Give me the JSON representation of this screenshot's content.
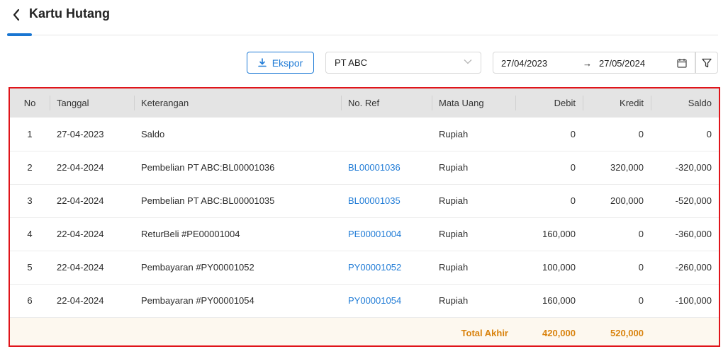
{
  "header": {
    "title": "Kartu Hutang"
  },
  "toolbar": {
    "export_label": "Ekspor",
    "company": "PT ABC",
    "date_start": "27/04/2023",
    "date_end": "27/05/2024",
    "arrow": "→"
  },
  "table": {
    "columns": [
      "No",
      "Tanggal",
      "Keterangan",
      "No. Ref",
      "Mata Uang",
      "Debit",
      "Kredit",
      "Saldo"
    ],
    "rows": [
      {
        "no": "1",
        "tanggal": "27-04-2023",
        "keterangan": "Saldo",
        "ref": "",
        "mata_uang": "Rupiah",
        "debit": "0",
        "kredit": "0",
        "saldo": "0"
      },
      {
        "no": "2",
        "tanggal": "22-04-2024",
        "keterangan": "Pembelian PT ABC:BL00001036",
        "ref": "BL00001036",
        "mata_uang": "Rupiah",
        "debit": "0",
        "kredit": "320,000",
        "saldo": "-320,000"
      },
      {
        "no": "3",
        "tanggal": "22-04-2024",
        "keterangan": "Pembelian PT ABC:BL00001035",
        "ref": "BL00001035",
        "mata_uang": "Rupiah",
        "debit": "0",
        "kredit": "200,000",
        "saldo": "-520,000"
      },
      {
        "no": "4",
        "tanggal": "22-04-2024",
        "keterangan": "ReturBeli #PE00001004",
        "ref": "PE00001004",
        "mata_uang": "Rupiah",
        "debit": "160,000",
        "kredit": "0",
        "saldo": "-360,000"
      },
      {
        "no": "5",
        "tanggal": "22-04-2024",
        "keterangan": "Pembayaran #PY00001052",
        "ref": "PY00001052",
        "mata_uang": "Rupiah",
        "debit": "100,000",
        "kredit": "0",
        "saldo": "-260,000"
      },
      {
        "no": "6",
        "tanggal": "22-04-2024",
        "keterangan": "Pembayaran #PY00001054",
        "ref": "PY00001054",
        "mata_uang": "Rupiah",
        "debit": "160,000",
        "kredit": "0",
        "saldo": "-100,000"
      }
    ],
    "total": {
      "label": "Total Akhir",
      "debit": "420,000",
      "kredit": "520,000"
    }
  },
  "colors": {
    "accent": "#1976d2",
    "link": "#1f7bd6",
    "total": "#d9830e",
    "highlight_border": "#e0141a"
  },
  "icons": {
    "back": "chevron-left-icon",
    "export": "download-icon",
    "dropdown": "chevron-down-icon",
    "calendar": "calendar-icon",
    "filter": "filter-icon"
  }
}
